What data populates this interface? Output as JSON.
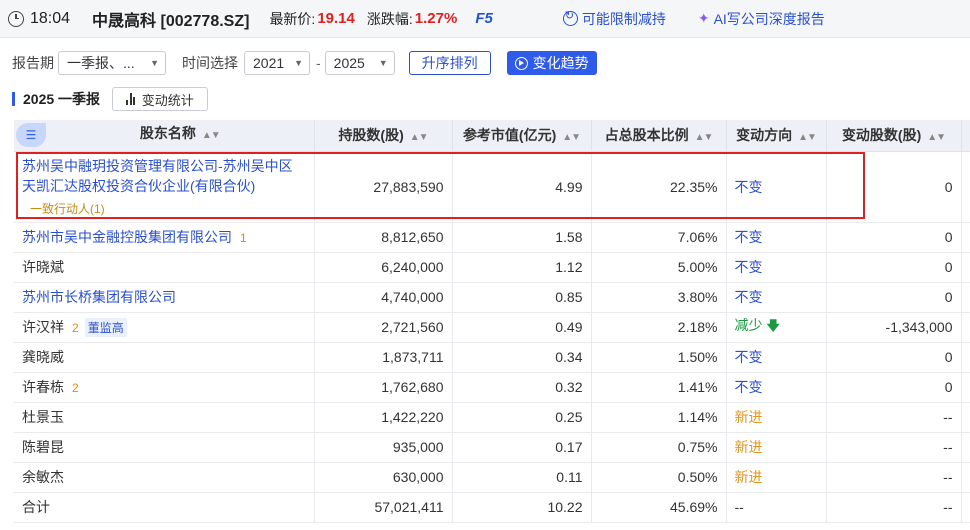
{
  "header": {
    "time": "18:04",
    "stock": "中晟高科 [002778.SZ]",
    "price_label": "最新价:",
    "price": "19.14",
    "change_label": "涨跌幅:",
    "change": "1.27%",
    "f5": "F5",
    "link_unlock": "可能限制减持",
    "link_ai": "AI写公司深度报告"
  },
  "filters": {
    "period_label": "报告期",
    "period_value": "一季报、...",
    "time_label": "时间选择",
    "year_from": "2021",
    "year_to": "2025",
    "dash": "-",
    "asc_button": "升序排列",
    "trend_button": "变化趋势"
  },
  "subbar": {
    "title": "2025 一季报",
    "stat_button": "变动统计"
  },
  "table": {
    "columns": [
      "股东名称",
      "持股数(股)",
      "参考市值(亿元)",
      "占总股本比例",
      "变动方向",
      "变动股数(股)"
    ],
    "rows": [
      {
        "name": "苏州吴中融玥投资管理有限公司-苏州吴中区天凯汇达股权投资合伙企业(有限合伙)",
        "note": "一致行动人(1)",
        "link": true,
        "shares": "27,883,590",
        "value": "4.99",
        "ratio": "22.35%",
        "direction": "不变",
        "dir_type": "same",
        "change": "0"
      },
      {
        "name": "苏州市吴中金融控股集团有限公司",
        "badge": "1",
        "link": true,
        "shares": "8,812,650",
        "value": "1.58",
        "ratio": "7.06%",
        "direction": "不变",
        "dir_type": "same",
        "change": "0"
      },
      {
        "name": "许晓斌",
        "link": false,
        "shares": "6,240,000",
        "value": "1.12",
        "ratio": "5.00%",
        "direction": "不变",
        "dir_type": "same",
        "change": "0"
      },
      {
        "name": "苏州市长桥集团有限公司",
        "link": true,
        "shares": "4,740,000",
        "value": "0.85",
        "ratio": "3.80%",
        "direction": "不变",
        "dir_type": "same",
        "change": "0"
      },
      {
        "name": "许汉祥",
        "badge": "2",
        "tag": "董监高",
        "link": false,
        "shares": "2,721,560",
        "value": "0.49",
        "ratio": "2.18%",
        "direction": "减少",
        "dir_type": "down",
        "change": "-1,343,000"
      },
      {
        "name": "龚晓威",
        "link": false,
        "shares": "1,873,711",
        "value": "0.34",
        "ratio": "1.50%",
        "direction": "不变",
        "dir_type": "same",
        "change": "0"
      },
      {
        "name": "许春栋",
        "badge": "2",
        "link": false,
        "shares": "1,762,680",
        "value": "0.32",
        "ratio": "1.41%",
        "direction": "不变",
        "dir_type": "same",
        "change": "0"
      },
      {
        "name": "杜景玉",
        "link": false,
        "shares": "1,422,220",
        "value": "0.25",
        "ratio": "1.14%",
        "direction": "新进",
        "dir_type": "new",
        "change": "--"
      },
      {
        "name": "陈碧昆",
        "link": false,
        "shares": "935,000",
        "value": "0.17",
        "ratio": "0.75%",
        "direction": "新进",
        "dir_type": "new",
        "change": "--"
      },
      {
        "name": "余敏杰",
        "link": false,
        "shares": "630,000",
        "value": "0.11",
        "ratio": "0.50%",
        "direction": "新进",
        "dir_type": "new",
        "change": "--"
      }
    ],
    "total": {
      "name": "合计",
      "shares": "57,021,411",
      "value": "10.22",
      "ratio": "45.69%",
      "direction": "--",
      "change": "--"
    }
  },
  "colors": {
    "accent": "#2f5bea",
    "up": "#e02020",
    "down": "#1a9a42",
    "new": "#e2961e",
    "highlight": "#e02020"
  }
}
